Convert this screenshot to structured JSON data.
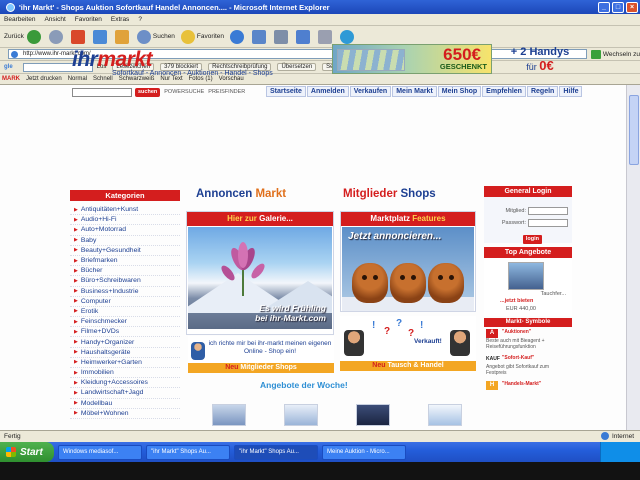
{
  "window": {
    "title": "'ihr Markt' - Shops Auktion Sofortkauf Handel Annoncen.... - Microsoft Internet Explorer"
  },
  "menu": [
    "Bearbeiten",
    "Ansicht",
    "Favoriten",
    "Extras",
    "?"
  ],
  "toolbar": {
    "back_label": "Zurück",
    "search_label": "Suchen",
    "favorites_label": "Favoriten"
  },
  "address": {
    "url": "http://www.ihr-markt.com/",
    "go_label": "Wechseln zu"
  },
  "google_bar": {
    "items": [
      "Los",
      "Lesezeichen",
      "379 blockiert",
      "Rechtschreibprüfung",
      "Übersetzen",
      "Senden an"
    ]
  },
  "links_bar": {
    "items": [
      "Jetzt drucken",
      "Normal",
      "Schnell",
      "Schwarzweiß",
      "Nur Text",
      "Fotos (1)",
      "Vorschau"
    ]
  },
  "site": {
    "logo_ihr": "ihr",
    "logo_markt": "markt",
    "tagline": "Sofortkauf - Annoncen - Auktionen - Handel - Shops",
    "promo_amount": "650€",
    "promo_gift": "GESCHENKT",
    "promo_handys_line1": "+ 2 Handys",
    "promo_handys_line2": "für",
    "promo_handys_price": "0€",
    "search_button": "suchen",
    "search_options": [
      "POWERSUCHE",
      "PREISFINDER"
    ]
  },
  "nav_tabs": [
    "Startseite",
    "Anmelden",
    "Verkaufen",
    "Mein Markt",
    "Mein Shop",
    "Empfehlen",
    "Regeln",
    "Hilfe"
  ],
  "categories": {
    "title": "Kategorien",
    "items": [
      "Antiquitäten+Kunst",
      "Audio+Hi-Fi",
      "Auto+Motorrad",
      "Baby",
      "Beauty+Gesundheit",
      "Briefmarken",
      "Bücher",
      "Büro+Schreibwaren",
      "Business+Industrie",
      "Computer",
      "Erotik",
      "Feinschmecker",
      "Filme+DVDs",
      "Handy+Organizer",
      "Haushaltsgeräte",
      "Heimwerker+Garten",
      "Immobilien",
      "Kleidung+Accessoires",
      "Landwirtschaft+Jagd",
      "Modellbau",
      "Möbel+Wohnen"
    ]
  },
  "sections": {
    "annoncen_1": "Annoncen",
    "annoncen_2": "Markt",
    "mitglieder_1": "Mitglieder",
    "mitglieder_2": "Shops",
    "gallery_head_1": "Hier zur",
    "gallery_head_2": "Galerie...",
    "gallery_caption_1": "Es wird Frühling",
    "gallery_caption_2": "bei ihr-Markt.com",
    "marktplatz_head_1": "Marktplatz",
    "marktplatz_head_2": "Features",
    "annoncieren": "Jetzt annoncieren...",
    "shop_text": "ich richte mir bei ihr-markt meinen eigenen Online - Shop ein!",
    "shop_strip_1": "Neu",
    "shop_strip_2": "Mitglieder Shops",
    "tausch_strip_1": "Neu",
    "tausch_strip_2": "Tausch & Handel",
    "verkauft": "Verkauft!",
    "offers_title": "Angebote der Woche!"
  },
  "right_sidebar": {
    "login_title": "General Login",
    "member_label": "Mitglied:",
    "password_label": "Passwort:",
    "login_button": "login",
    "top_title": "Top Angebote",
    "top_item": "Tauchfer...",
    "top_cta": "...jetzt bieten",
    "top_price": "EUR 440,00",
    "symbols_title": "Markt- Symbole",
    "symbols": [
      {
        "icon": "A",
        "label": "\"Auktionen\"",
        "desc": "Beste auch mit Bieagent + Reiseführungsfunktion"
      },
      {
        "icon": "KAUF",
        "label": "\"Sofort-Kauf\"",
        "desc": "Angebot gibt Sofortkauf zum Festpreis"
      },
      {
        "icon": "H",
        "label": "\"Handels-Markt\"",
        "desc": ""
      }
    ]
  },
  "status": {
    "text": "Fertig",
    "zone": "Internet"
  },
  "taskbar": {
    "start": "Start",
    "items": [
      "Windows mediasof...",
      "\"ihr Markt\" Shops Au...",
      "\"ihr Markt\" Shops Au...",
      "Meine Auktion - Micro..."
    ]
  }
}
